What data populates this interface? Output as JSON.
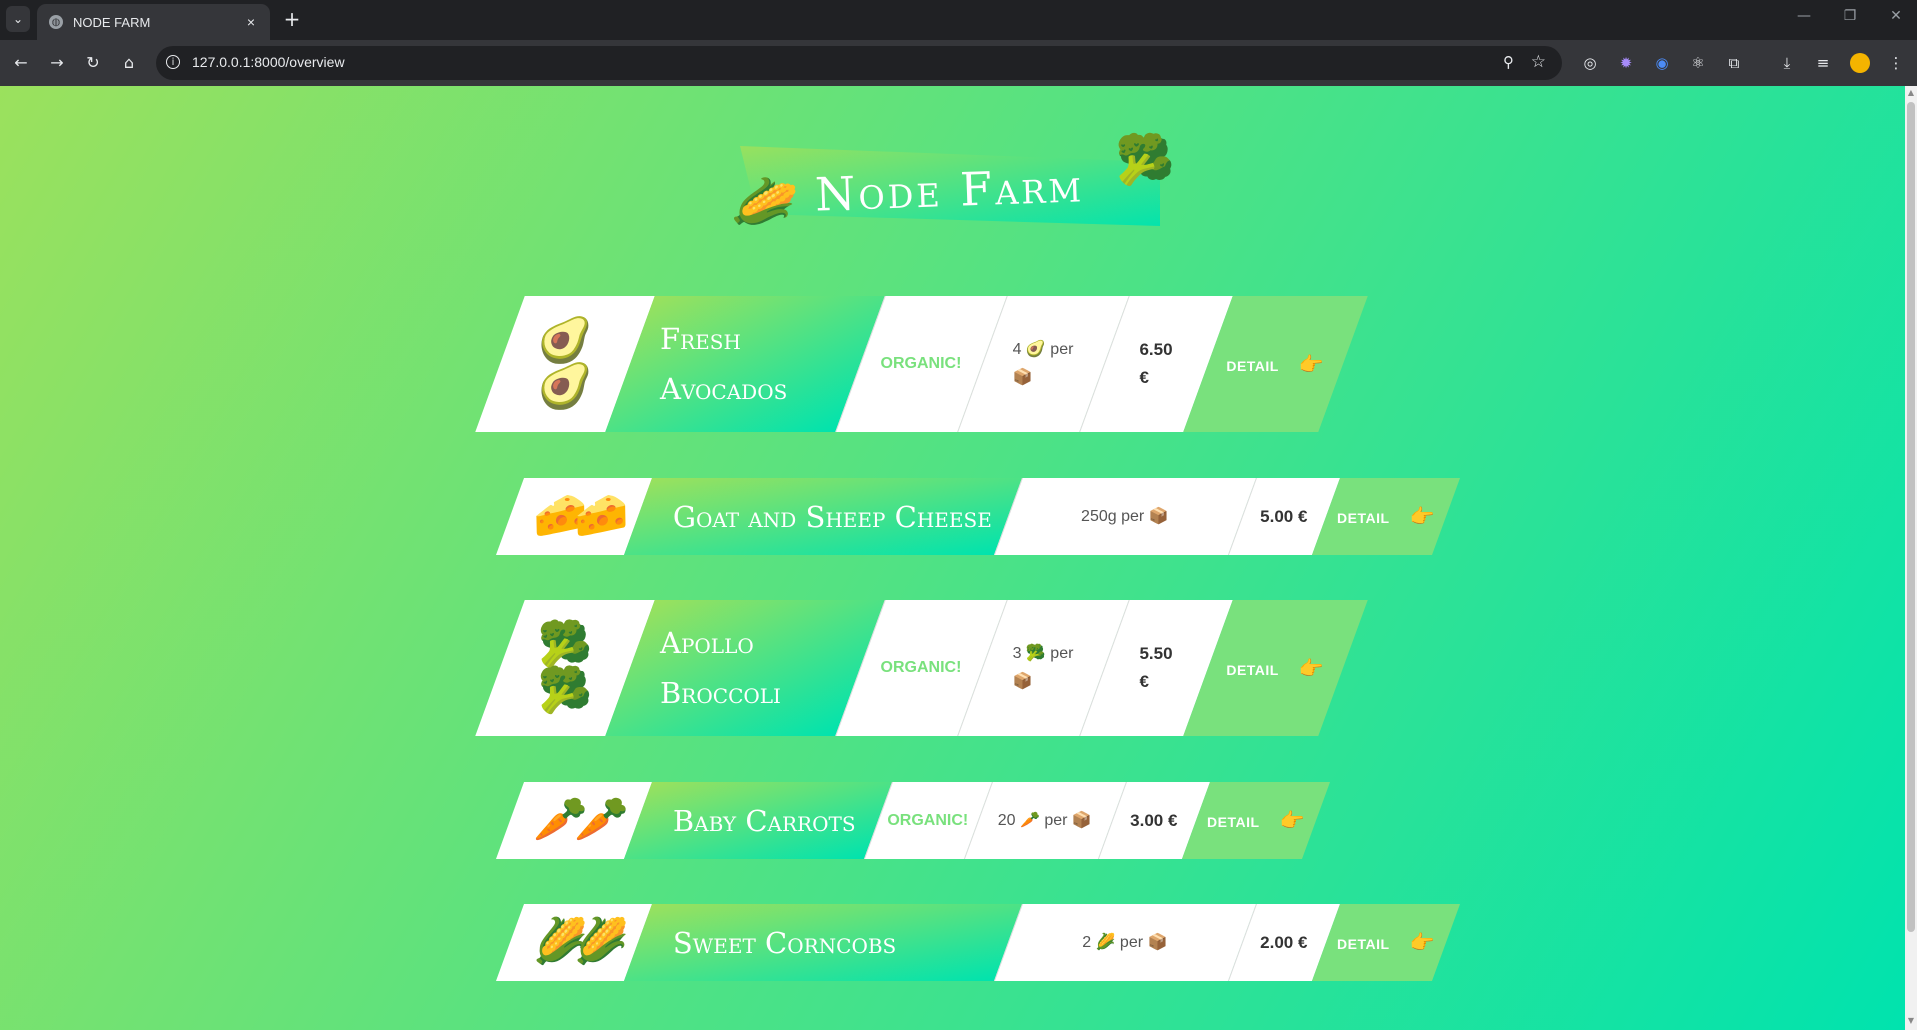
{
  "browser": {
    "tab_title": "NODE FARM",
    "url": "127.0.0.1:8000/overview",
    "new_tab_symbol": "+",
    "close_symbol": "×"
  },
  "page": {
    "title": "Node Farm",
    "title_left_emoji": "🌽",
    "title_right_emoji": "🥦",
    "detail_label": "DETAIL",
    "detail_emoji": "👉",
    "organic_label": "ORGANIC!",
    "per_label": "per",
    "box_emoji": "📦"
  },
  "products": [
    {
      "emoji": "🥑",
      "name": "Fresh Avocados",
      "organic": true,
      "quantity": "4",
      "price": "6.50 €",
      "emoji_count": 2
    },
    {
      "emoji": "🧀",
      "name": "Goat and Sheep Cheese",
      "organic": false,
      "quantity": "250g",
      "price": "5.00 €",
      "emoji_count": 2
    },
    {
      "emoji": "🥦",
      "name": "Apollo Broccoli",
      "organic": true,
      "quantity": "3",
      "price": "5.50 €",
      "emoji_count": 2
    },
    {
      "emoji": "🥕",
      "name": "Baby Carrots",
      "organic": true,
      "quantity": "20",
      "price": "3.00 €",
      "emoji_count": 2
    },
    {
      "emoji": "🌽",
      "name": "Sweet Corncobs",
      "organic": false,
      "quantity": "2",
      "price": "2.00 €",
      "emoji_count": 2
    }
  ]
}
